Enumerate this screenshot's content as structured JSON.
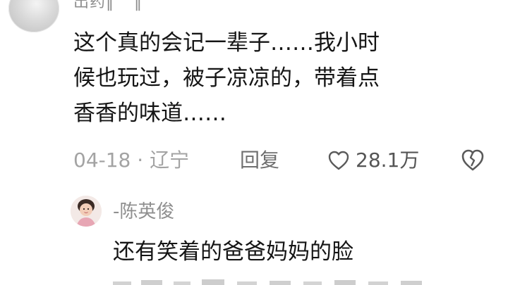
{
  "comment": {
    "author": "出药‖ ˘ ‖",
    "text_lines": [
      "这个真的会记一辈子……我小时",
      "候也玩过，被子凉凉的，带着点",
      "香香的味道……"
    ],
    "date": "04-18",
    "separator": "·",
    "location": "辽宁",
    "reply_label": "回复",
    "like_count": "28.1万",
    "icons": {
      "like": "heart-outline-icon",
      "dislike": "broken-heart-icon"
    }
  },
  "reply": {
    "author": "-陈英俊",
    "text": "还有笑着的爸爸妈妈的脸",
    "icons": {
      "avatar": "child-photo-avatar"
    }
  },
  "colors": {
    "text_primary": "#151515",
    "text_secondary": "#8f8f8f",
    "meta": "#a3a3a3",
    "background": "#ffffff"
  }
}
